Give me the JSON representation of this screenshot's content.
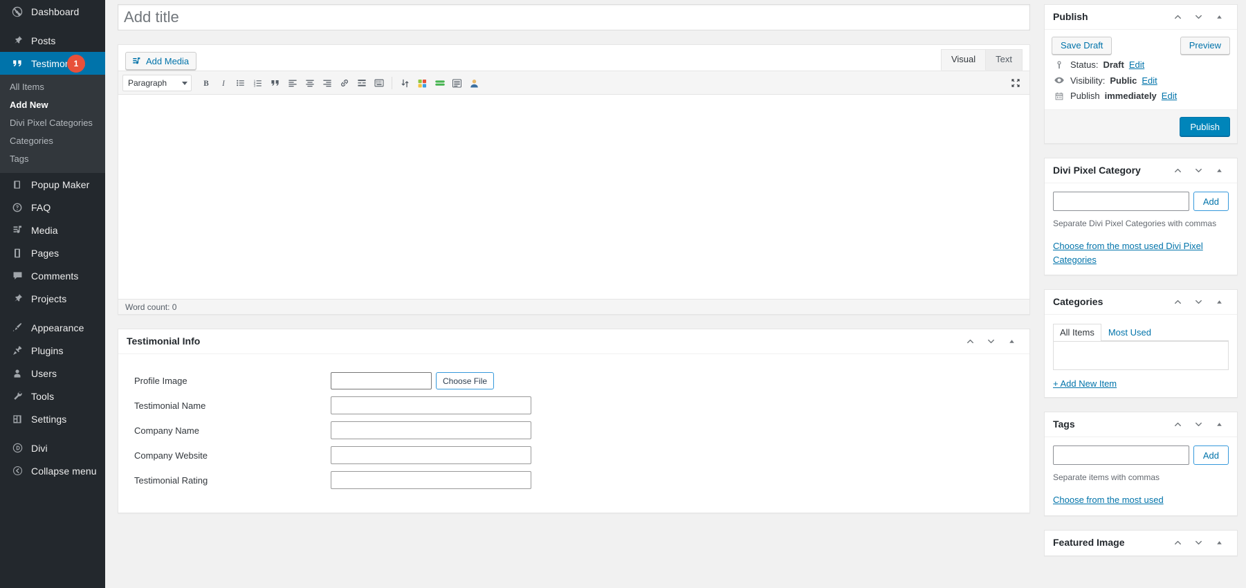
{
  "sidebar": {
    "items": [
      {
        "label": "Dashboard",
        "icon": "dashboard-icon",
        "current": false
      },
      {
        "label": "Posts",
        "icon": "pin-icon",
        "current": false
      },
      {
        "label": "Testimonials",
        "icon": "quote-icon",
        "current": true,
        "badge": "1"
      },
      {
        "label": "Popup Maker",
        "icon": "book-icon",
        "current": false
      },
      {
        "label": "FAQ",
        "icon": "question-icon",
        "current": false
      },
      {
        "label": "Media",
        "icon": "media-icon",
        "current": false
      },
      {
        "label": "Pages",
        "icon": "pages-icon",
        "current": false
      },
      {
        "label": "Comments",
        "icon": "comment-icon",
        "current": false
      },
      {
        "label": "Projects",
        "icon": "pin-icon",
        "current": false
      },
      {
        "label": "Appearance",
        "icon": "brush-icon",
        "current": false
      },
      {
        "label": "Plugins",
        "icon": "plug-icon",
        "current": false
      },
      {
        "label": "Users",
        "icon": "user-icon",
        "current": false
      },
      {
        "label": "Tools",
        "icon": "wrench-icon",
        "current": false
      },
      {
        "label": "Settings",
        "icon": "settings-icon",
        "current": false
      },
      {
        "label": "Divi",
        "icon": "divi-icon",
        "current": false
      },
      {
        "label": "Collapse menu",
        "icon": "collapse-icon",
        "current": false
      }
    ],
    "submenu": [
      {
        "label": "All Items",
        "current": false
      },
      {
        "label": "Add New",
        "current": true
      },
      {
        "label": "Divi Pixel Categories",
        "current": false
      },
      {
        "label": "Categories",
        "current": false
      },
      {
        "label": "Tags",
        "current": false
      }
    ]
  },
  "title": {
    "placeholder": "Add title",
    "value": ""
  },
  "editor": {
    "add_media_label": "Add Media",
    "tabs": [
      {
        "label": "Visual",
        "active": true
      },
      {
        "label": "Text",
        "active": false
      }
    ],
    "format_select": "Paragraph",
    "statusbar": "Word count: 0",
    "toolbar_icons": [
      "bold-icon",
      "italic-icon",
      "bulleted-list-icon",
      "numbered-list-icon",
      "blockquote-icon",
      "align-left-icon",
      "align-center-icon",
      "align-right-icon",
      "link-icon",
      "read-more-icon",
      "toolbar-toggle-icon"
    ],
    "toolbar_icons_group2": [
      "divi-builder-icon",
      "shortcodes-icon",
      "button-icon",
      "list-block-icon",
      "person-icon"
    ],
    "fullscreen_icon": "distraction-free-icon"
  },
  "testimonial_info": {
    "title": "Testimonial Info",
    "fields": [
      {
        "label": "Profile Image",
        "type": "file",
        "value": "",
        "button": "Choose File"
      },
      {
        "label": "Testimonial Name",
        "type": "text",
        "value": ""
      },
      {
        "label": "Company Name",
        "type": "text",
        "value": ""
      },
      {
        "label": "Company Website",
        "type": "text",
        "value": ""
      },
      {
        "label": "Testimonial Rating",
        "type": "text",
        "value": ""
      }
    ]
  },
  "publish_box": {
    "title": "Publish",
    "save_draft": "Save Draft",
    "preview": "Preview",
    "status_label": "Status:",
    "status_value": "Draft",
    "status_edit": "Edit",
    "visibility_label": "Visibility:",
    "visibility_value": "Public",
    "visibility_edit": "Edit",
    "schedule_label": "Publish",
    "schedule_value": "immediately",
    "schedule_edit": "Edit",
    "publish": "Publish"
  },
  "divi_pixel_category_box": {
    "title": "Divi Pixel Category",
    "input_value": "",
    "add_label": "Add",
    "helper": "Separate Divi Pixel Categories with commas",
    "most_used_link": "Choose from the most used Divi Pixel Categories"
  },
  "categories_box": {
    "title": "Categories",
    "tabs": [
      {
        "label": "All Items",
        "active": true
      },
      {
        "label": "Most Used",
        "active": false
      }
    ],
    "add_new_item": "+ Add New Item"
  },
  "tags_box": {
    "title": "Tags",
    "input_value": "",
    "add_label": "Add",
    "helper": "Separate items with commas",
    "most_used_link": "Choose from the most used"
  },
  "featured_image_box": {
    "title": "Featured Image"
  },
  "colors": {
    "sidebar_bg": "#23282d",
    "submenu_bg": "#32373c",
    "accent": "#0073aa",
    "primary_button": "#0085ba",
    "badge": "#e8503a"
  }
}
